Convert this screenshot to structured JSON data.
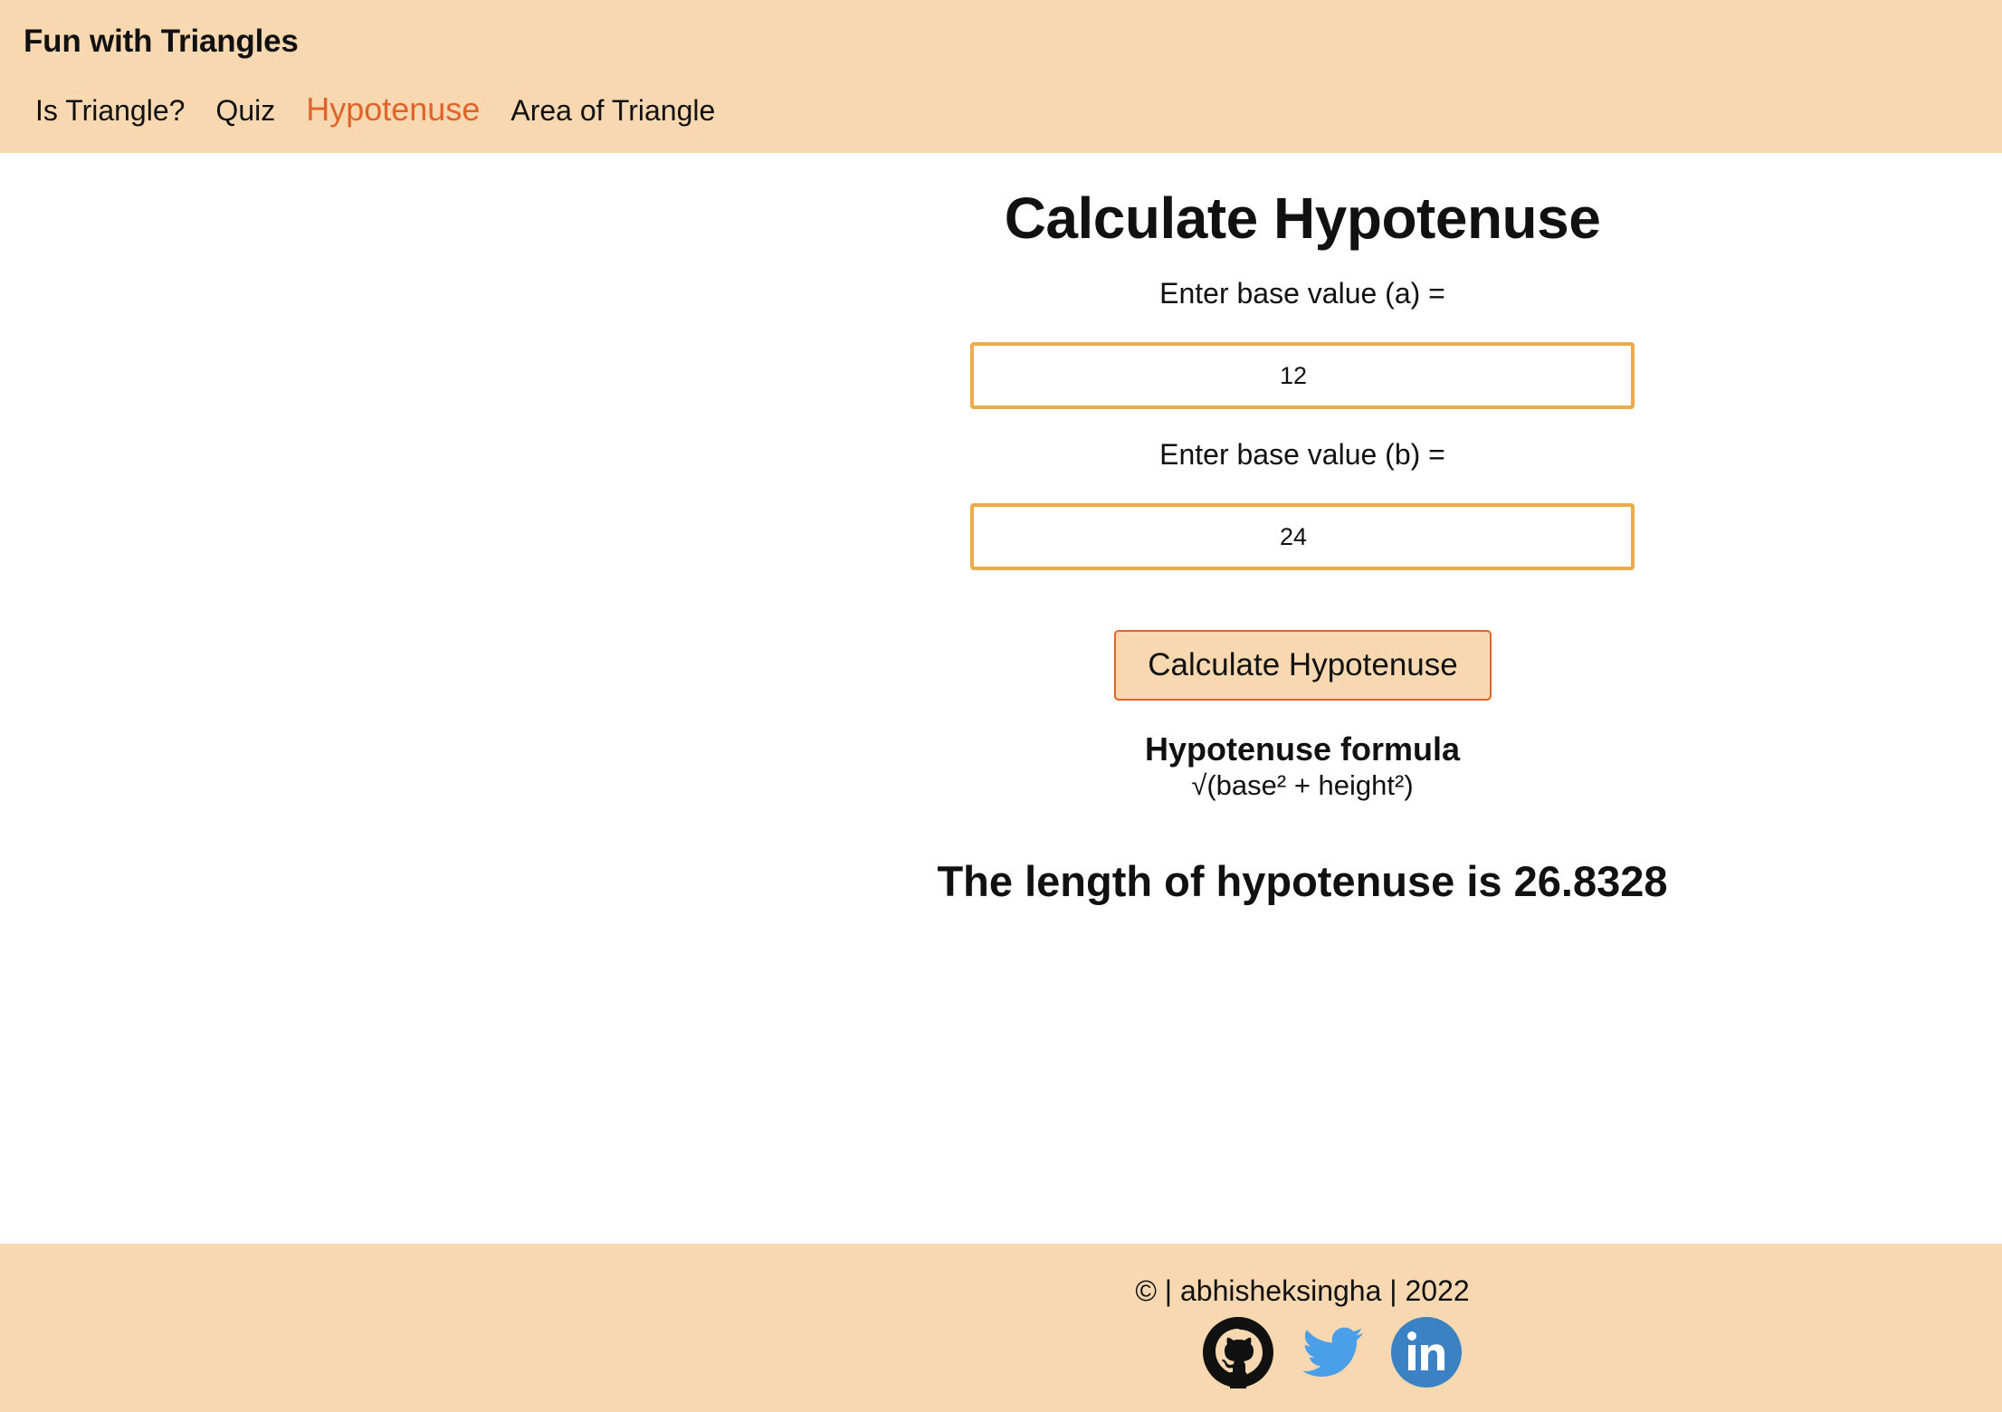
{
  "header": {
    "brand": "Fun with Triangles",
    "nav": [
      {
        "label": "Is Triangle?",
        "active": false
      },
      {
        "label": "Quiz",
        "active": false
      },
      {
        "label": "Hypotenuse",
        "active": true
      },
      {
        "label": "Area of Triangle",
        "active": false
      }
    ]
  },
  "main": {
    "title": "Calculate Hypotenuse",
    "input_a": {
      "label": "Enter base value (a) =",
      "value": "12"
    },
    "input_b": {
      "label": "Enter base value (b) =",
      "value": "24"
    },
    "button_label": "Calculate Hypotenuse",
    "formula_title": "Hypotenuse formula",
    "formula": "√(base² + height²)",
    "result": "The length of hypotenuse is 26.8328"
  },
  "footer": {
    "copyright": "© | abhisheksingha | 2022",
    "socials": [
      {
        "icon": "github-icon",
        "color": "#111111"
      },
      {
        "icon": "twitter-icon",
        "color": "#4a9fe8"
      },
      {
        "icon": "linkedin-icon",
        "color": "#3b82c4"
      }
    ]
  },
  "colors": {
    "header_bg": "#f7d8b1",
    "accent": "#e0642a",
    "input_border": "#ecab4a"
  }
}
